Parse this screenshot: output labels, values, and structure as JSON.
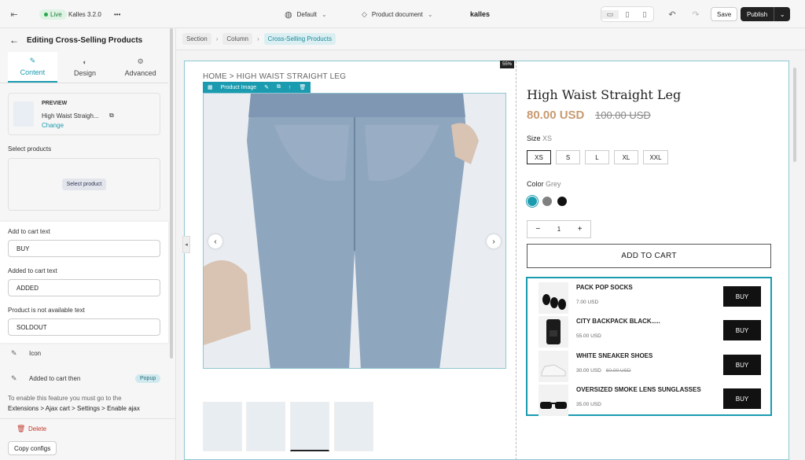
{
  "topbar": {
    "live": "Live",
    "version": "Kalles 3.2.0",
    "more": "•••",
    "page": "Default",
    "template": "Product document",
    "brand": "kalles",
    "save": "Save",
    "publish": "Publish"
  },
  "sidebar": {
    "title": "Editing Cross-Selling Products",
    "tabs": [
      {
        "label": "Content",
        "icon": "pencil-icon"
      },
      {
        "label": "Design",
        "icon": "palette-icon"
      },
      {
        "label": "Advanced",
        "icon": "gear-icon"
      }
    ],
    "preview_label": "PREVIEW",
    "preview_name": "High Waist Straigh...",
    "change": "Change",
    "select_products": "Select products",
    "select_product_btn": "Select product",
    "add_to_cart_label": "Add to cart text",
    "add_to_cart_value": "BUY",
    "added_label": "Added to cart text",
    "added_value": "ADDED",
    "not_available_label": "Product is not available text",
    "not_available_value": "SOLDOUT",
    "icon_item": "Icon",
    "added_then": "Added to cart then",
    "popup": "Popup",
    "note1": "To enable this feature you must go to the",
    "note2": "Extensions > Ajax cart > Settings > Enable ajax",
    "delete": "Delete",
    "copy": "Copy configs"
  },
  "breadcrumb": [
    "Section",
    "Column",
    "Cross-Selling Products"
  ],
  "canvas": {
    "size_badge": "55%",
    "bread": "HOME  >  HIGH WAIST STRAIGHT LEG",
    "image_tool": "Product Image"
  },
  "product": {
    "title": "High Waist Straight Leg",
    "price": "80.00 USD",
    "old_price": "100.00 USD",
    "size_label": "Size",
    "size_value": "XS",
    "sizes": [
      "XS",
      "S",
      "L",
      "XL",
      "XXL"
    ],
    "color_label": "Color",
    "color_value": "Grey",
    "swatches": [
      "#1a9bb0",
      "#808080",
      "#111111"
    ],
    "qty_minus": "−",
    "qty": "1",
    "qty_plus": "+",
    "add_to_cart": "ADD TO CART"
  },
  "cross_sell": [
    {
      "name": "PACK POP SOCKS",
      "price": "7.00 USD",
      "old": "",
      "buy": "BUY"
    },
    {
      "name": "CITY BACKPACK BLACK.....",
      "price": "55.00 USD",
      "old": "",
      "buy": "BUY"
    },
    {
      "name": "WHITE SNEAKER SHOES",
      "price": "30.00 USD",
      "old": "60.00 USD",
      "buy": "BUY"
    },
    {
      "name": "OVERSIZED SMOKE LENS SUNGLASSES",
      "price": "35.00 USD",
      "old": "",
      "buy": "BUY"
    }
  ]
}
